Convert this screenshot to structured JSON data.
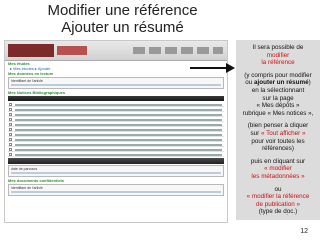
{
  "slide": {
    "title_line1": "Modifier une référence",
    "title_line2": "Ajouter un résumé",
    "page_number": "12"
  },
  "screenshot": {
    "section_mes_etudes": "Mes études",
    "link_mes_etudes": "▸ Mes études  ▸ Ajouter",
    "section_aide_notes": "Mes données en lecture",
    "field_identifiant": "Identifiant de l'article",
    "field_date": "date de parcours",
    "section_biblio": "Mes Notices Bibliographiques",
    "section_confidentiels": "Mes documents confidentiels",
    "field_identifiant2": "Identifiant de l'article",
    "field_date2": "date de parcours"
  },
  "panel": {
    "p1_a": "Il sera possible de",
    "p1_b": "modifier",
    "p1_c": "la référence",
    "p2_a": "(y compris pour modifier",
    "p2_b": "ou",
    "p2_c": "ajouter un résumé",
    "p2_d": ")",
    "p2_e": "en la sélectionnant",
    "p2_f": "sur la page",
    "p2_g": "« Mes dépôts »",
    "p2_h": "rubrique « Mes notices »,",
    "p3_a": "(bien penser à cliquer",
    "p3_b": "sur",
    "p3_c": "« Tout afficher »",
    "p3_d": "pour voir toutes les références)",
    "p4_a": "puis en cliquant sur",
    "p4_b": "« modifier",
    "p4_c": "les métadonnées »",
    "p5_a": "ou",
    "p5_b": "« modifier la référence",
    "p5_c": "de publication »",
    "p5_d": "(type de doc.)"
  },
  "colors": {
    "accent_red": "#cc1111",
    "panel_bg": "#dcdcdc",
    "green_heading": "#2e8b2e"
  }
}
